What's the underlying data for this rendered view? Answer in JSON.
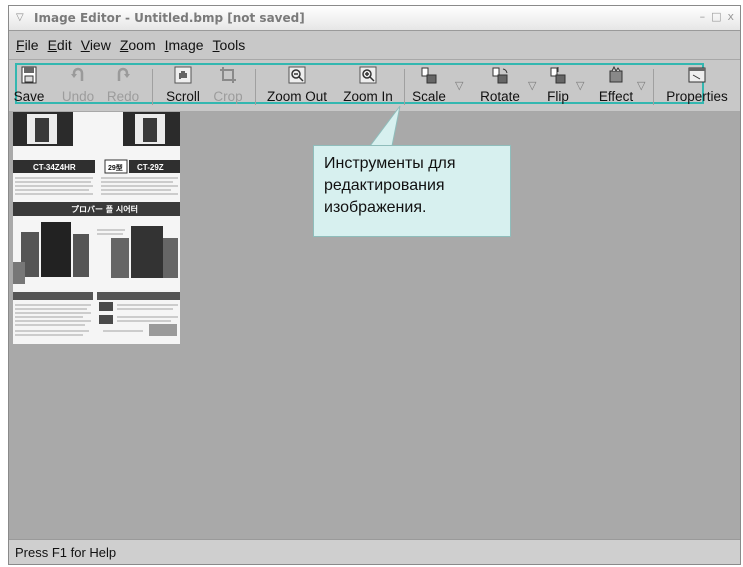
{
  "window": {
    "title": "Image Editor - Untitled.bmp [not saved]",
    "controls": [
      "–",
      "□",
      "x"
    ]
  },
  "menubar": {
    "items": [
      {
        "label": "File",
        "underline": "F"
      },
      {
        "label": "Edit",
        "underline": "E"
      },
      {
        "label": "View",
        "underline": "V"
      },
      {
        "label": "Zoom",
        "underline": "Z"
      },
      {
        "label": "Image",
        "underline": "I"
      },
      {
        "label": "Tools",
        "underline": "T"
      }
    ]
  },
  "toolbar": {
    "save": "Save",
    "undo": "Undo",
    "redo": "Redo",
    "scroll": "Scroll",
    "crop": "Crop",
    "zoom_out": "Zoom Out",
    "zoom_in": "Zoom In",
    "scale": "Scale",
    "rotate": "Rotate",
    "flip": "Flip",
    "effect": "Effect",
    "properties": "Properties"
  },
  "callout": {
    "text": "Инструменты для редактирования изображения."
  },
  "statusbar": {
    "text": "Press F1 for Help"
  },
  "thumbnail": {
    "model_text_1": "CT-34Z4HR",
    "badge_text": "29型",
    "model_text_2": "CT-29Z",
    "banner_text": "プロバー 플 시어터"
  },
  "colors": {
    "highlight": "#33b7b0",
    "callout_bg": "#d7f0ef"
  }
}
